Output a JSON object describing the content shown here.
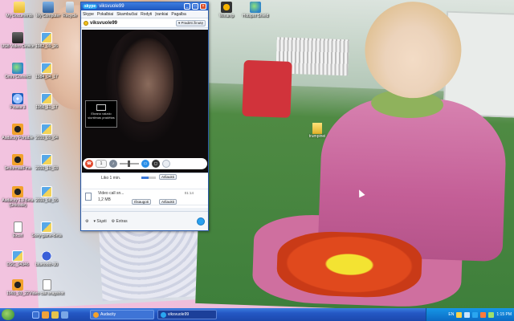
{
  "desktop": {
    "icons": [
      {
        "label": "My Documents",
        "glyph": "g-folder"
      },
      {
        "label": "My Computer",
        "glyph": "g-pc"
      },
      {
        "label": "Recycle",
        "glyph": "g-bin"
      },
      {
        "label": "USB Video Device",
        "glyph": "g-camera"
      },
      {
        "label": "Omni Connect",
        "glyph": "g-globe"
      },
      {
        "label": "Picasa 3",
        "glyph": "g-disc"
      },
      {
        "label": "Audacity Portable",
        "glyph": "g-headset"
      },
      {
        "label": "Setformat/Fmo",
        "glyph": "g-headset"
      },
      {
        "label": "Audacity 1.3 Beta (Unicode)",
        "glyph": "g-headset"
      },
      {
        "label": "Excel",
        "glyph": "g-doc"
      },
      {
        "label": "Sony game-Beta",
        "glyph": "g-pic"
      },
      {
        "label": "DSC_04346",
        "glyph": "g-pic"
      },
      {
        "label": "bluetooth-30",
        "glyph": "g-bt"
      },
      {
        "label": "1965_03_22",
        "glyph": "g-headset"
      },
      {
        "label": "Video call snapshot",
        "glyph": "g-doc"
      },
      {
        "label": "1982_09_26",
        "glyph": "g-pic"
      },
      {
        "label": "1984_04_17",
        "glyph": "g-pic"
      },
      {
        "label": "1956_11_17",
        "glyph": "g-pic"
      },
      {
        "label": "2010_09_04",
        "glyph": "g-pic"
      },
      {
        "label": "2010_10_03",
        "glyph": "g-pic"
      },
      {
        "label": "2010_08_05",
        "glyph": "g-pic"
      },
      {
        "label": "Winamp",
        "glyph": "g-winamp"
      },
      {
        "label": "Hotspot Shield",
        "glyph": "g-globe"
      }
    ],
    "photo_folder": "trumpinei"
  },
  "skype": {
    "app": "skype",
    "title": "viksvuole99",
    "menu": [
      "Skype",
      "Pokalbiai",
      "Skambučiai",
      "Rodyti",
      "Įrankiai",
      "Pagalba"
    ],
    "contact": "viksvuole99",
    "start_video_label": "Pradėti žinutę",
    "preview_text": "Ekrano vaizdo siuntimas pradėtas",
    "call": {
      "count": "1"
    },
    "chat": {
      "row1_text": "Liko 1 min.",
      "row1_progress_pct": 50,
      "row1_button": "Atšaukti",
      "file_name": "Video call sn...",
      "file_size": "1,2 MB",
      "file_time": "01:14",
      "save_button": "Išsaugoti",
      "cancel_button": "Atšaukti"
    },
    "bottom": {
      "send_file": "Siųsti",
      "extras": "Extras"
    }
  },
  "taskbar": {
    "tasks": [
      "Audacity",
      "viksvuole99"
    ],
    "lang": "EN",
    "time": "1:15 PM"
  }
}
